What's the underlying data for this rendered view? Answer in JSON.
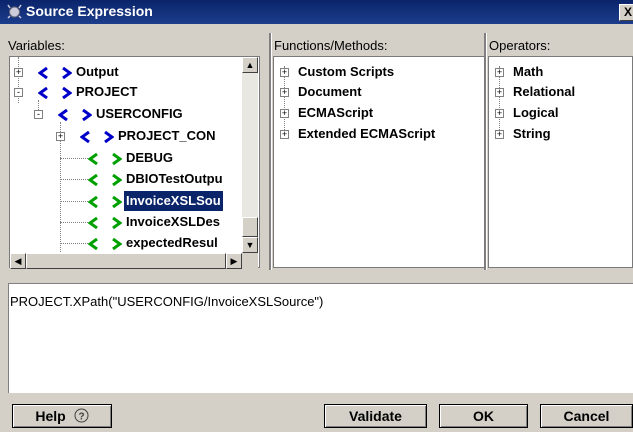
{
  "window": {
    "title": "Source Expression",
    "close_label": "X"
  },
  "panels": {
    "variables_label": "Variables:",
    "functions_label": "Functions/Methods:",
    "operators_label": "Operators:"
  },
  "variables_tree": [
    {
      "label": "Output",
      "expander": "+"
    },
    {
      "label": "PROJECT",
      "expander": "-"
    },
    {
      "label": "USERCONFIG",
      "expander": "-"
    },
    {
      "label": "PROJECT_CON",
      "expander": "+"
    },
    {
      "label": "DEBUG"
    },
    {
      "label": "DBIOTestOutpu"
    },
    {
      "label": "InvoiceXSLSou",
      "selected": true
    },
    {
      "label": "InvoiceXSLDes"
    },
    {
      "label": "expectedResul"
    }
  ],
  "functions_tree": [
    {
      "label": "Custom Scripts",
      "expander": "+"
    },
    {
      "label": "Document",
      "expander": "+"
    },
    {
      "label": "ECMAScript",
      "expander": "+"
    },
    {
      "label": "Extended ECMAScript",
      "expander": "+"
    }
  ],
  "operators_tree": [
    {
      "label": "Math",
      "expander": "+"
    },
    {
      "label": "Relational",
      "expander": "+"
    },
    {
      "label": "Logical",
      "expander": "+"
    },
    {
      "label": "String",
      "expander": "+"
    }
  ],
  "expression": {
    "value": "PROJECT.XPath(\"USERCONFIG/InvoiceXSLSource\")"
  },
  "buttons": {
    "help": "Help",
    "validate": "Validate",
    "ok": "OK",
    "cancel": "Cancel"
  },
  "colors": {
    "variable_icon_blue": "#0000c8",
    "variable_icon_green": "#00a000",
    "selection": "#0a246a"
  }
}
